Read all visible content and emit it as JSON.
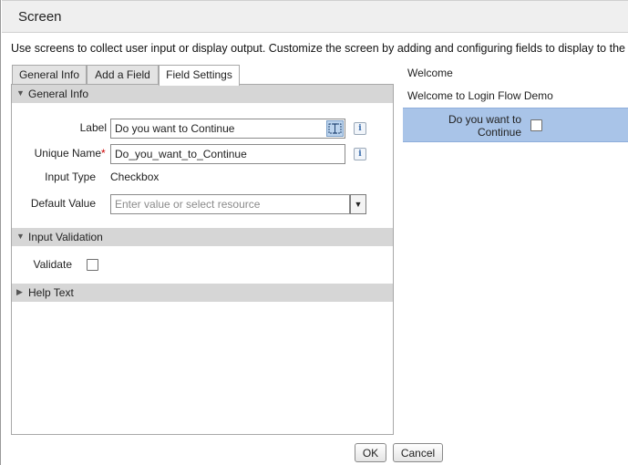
{
  "window": {
    "title": "Screen"
  },
  "description": "Use screens to collect user input or display output. Customize the screen by adding and configuring fields to display to the user.",
  "tabs": [
    {
      "label": "General Info",
      "active": false
    },
    {
      "label": "Add a Field",
      "active": false
    },
    {
      "label": "Field Settings",
      "active": true
    }
  ],
  "sections": {
    "general_info": {
      "title": "General Info",
      "expanded": true,
      "label_caption": "Label",
      "label_value": "Do you want to Continue",
      "unique_name_caption": "Unique Name",
      "required_marker": "*",
      "unique_name_value": "Do_you_want_to_Continue",
      "input_type_caption": "Input Type",
      "input_type_value": "Checkbox",
      "default_value_caption": "Default Value",
      "default_value_placeholder": "Enter value or select resource",
      "info_glyph": "i"
    },
    "input_validation": {
      "title": "Input Validation",
      "expanded": true,
      "validate_caption": "Validate",
      "validate_checked": false
    },
    "help_text": {
      "title": "Help Text",
      "expanded": false
    }
  },
  "preview": {
    "heading": "Welcome",
    "message": "Welcome to Login Flow Demo",
    "field_label": "Do you want to Continue",
    "field_checked": false,
    "highlight_color": "#a9c4e8"
  },
  "buttons": {
    "ok": "OK",
    "cancel": "Cancel"
  }
}
